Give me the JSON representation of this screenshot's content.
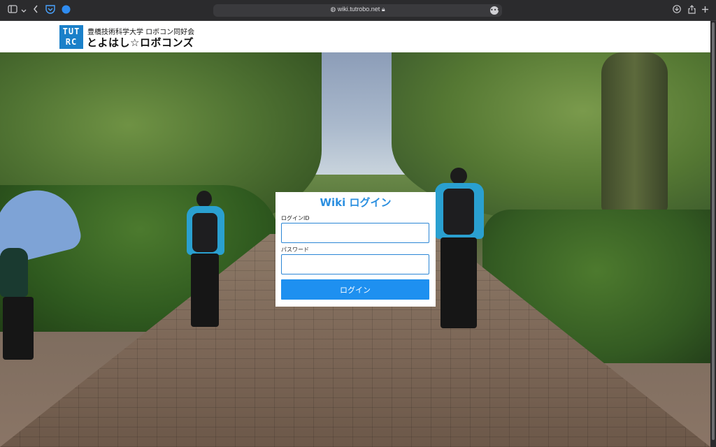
{
  "browser": {
    "url": "wiki.tutrobo.net",
    "icons": {
      "sidebar": "sidebar-icon",
      "dropdown": "chevron-down-icon",
      "back": "chevron-left-icon",
      "pocket": "pocket-icon",
      "extension": "extension-icon",
      "lock": "lock-icon",
      "more": "more-icon",
      "download": "download-icon",
      "share": "share-icon",
      "new_tab": "plus-icon"
    }
  },
  "header": {
    "logo_top": "TUT",
    "logo_bottom": "RC",
    "org_subtitle": "豊橋技術科学大学 ロボコン同好会",
    "org_title": "とよはし☆ロボコンズ"
  },
  "login": {
    "title": "Wiki ログイン",
    "id_label": "ログインID",
    "id_value": "",
    "password_label": "パスワード",
    "password_value": "",
    "submit_label": "ログイン"
  },
  "colors": {
    "accent": "#1e90f0",
    "title": "#2b8fe0",
    "logo": "#1a80c9"
  }
}
